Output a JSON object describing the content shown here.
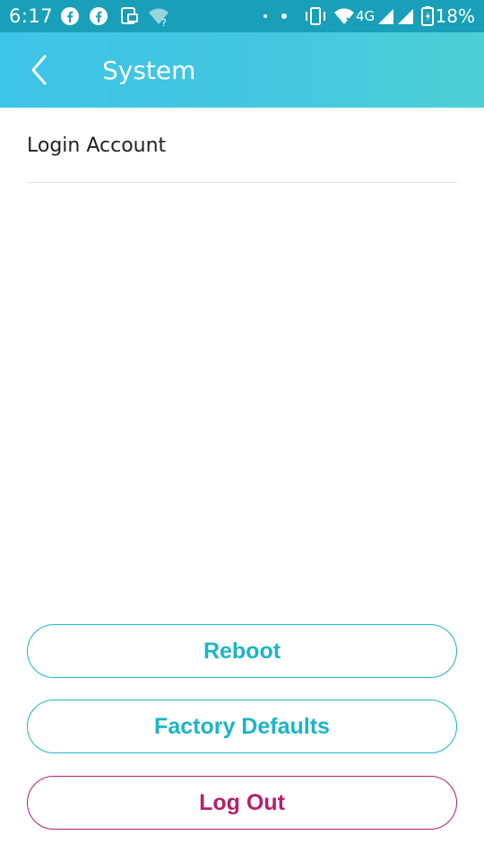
{
  "status_bar": {
    "time": "6:17",
    "network": "4G",
    "battery": "18%"
  },
  "header": {
    "title": "System"
  },
  "list": {
    "items": [
      {
        "label": "Login Account"
      }
    ]
  },
  "buttons": {
    "reboot": "Reboot",
    "factory_defaults": "Factory Defaults",
    "log_out": "Log Out"
  },
  "colors": {
    "status_bar": "#19a0b8",
    "header_start": "#3cc3e8",
    "header_end": "#4dcfd6",
    "accent": "#1cb4c7",
    "logout": "#b3206d"
  },
  "icons": {
    "back": "chevron-left-icon",
    "status": [
      "facebook-icon",
      "facebook-icon",
      "cast-icon",
      "wifi-question-icon",
      "vibrate-icon",
      "wifi-icon",
      "signal-icon",
      "battery-icon"
    ]
  }
}
